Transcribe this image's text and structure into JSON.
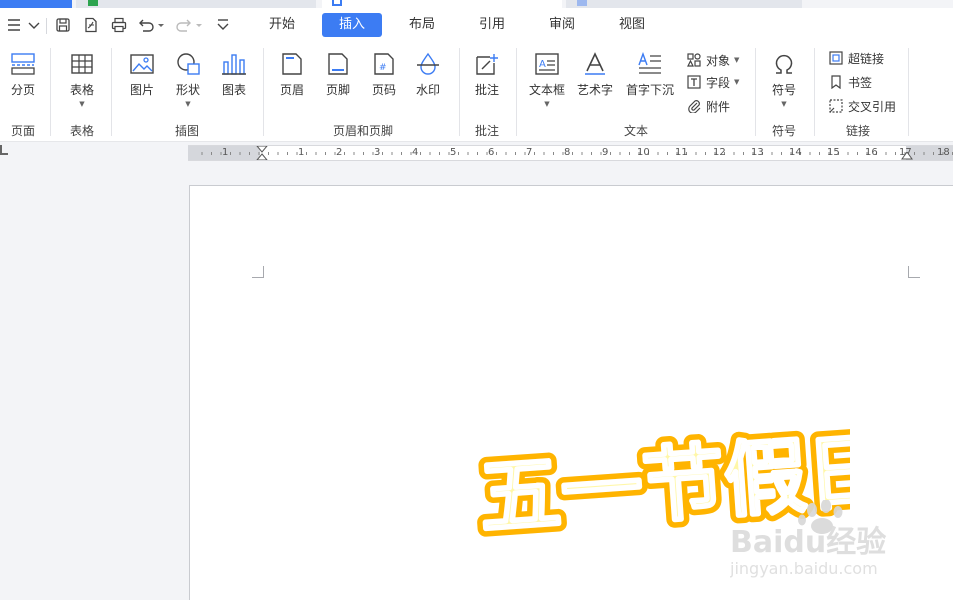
{
  "menu": {
    "tabs": [
      {
        "label": "开始",
        "active": false
      },
      {
        "label": "插入",
        "active": true
      },
      {
        "label": "布局",
        "active": false
      },
      {
        "label": "引用",
        "active": false
      },
      {
        "label": "审阅",
        "active": false
      },
      {
        "label": "视图",
        "active": false
      }
    ]
  },
  "ribbon": {
    "page_break": "分页",
    "table": "表格",
    "picture": "图片",
    "shape": "形状",
    "chart": "图表",
    "header": "页眉",
    "footer": "页脚",
    "page_number": "页码",
    "watermark": "水印",
    "comment": "批注",
    "textbox": "文本框",
    "wordart": "艺术字",
    "dropcap": "首字下沉",
    "object": "对象",
    "field": "字段",
    "attachment": "附件",
    "symbol": "符号",
    "hyperlink": "超链接",
    "bookmark": "书签",
    "crossref": "交叉引用",
    "groups": {
      "page": "页面",
      "table": "表格",
      "illustration": "插图",
      "header_footer": "页眉和页脚",
      "comment": "批注",
      "text": "文本",
      "symbol": "符号",
      "link": "链接"
    }
  },
  "ruler": {
    "numbers": [
      "1",
      "1",
      "2",
      "3",
      "4",
      "5",
      "6",
      "7",
      "8",
      "9",
      "10",
      "11",
      "12",
      "13",
      "14",
      "15",
      "16",
      "17",
      "18"
    ]
  },
  "document": {
    "wordart_text": "五一节假日"
  },
  "watermark": {
    "brand": "Baidu经验",
    "url": "jingyan.baidu.com"
  },
  "colors": {
    "accent": "#3c7cf3",
    "wordart_fill": "#fff7a8",
    "wordart_stroke": "#ffb400"
  }
}
